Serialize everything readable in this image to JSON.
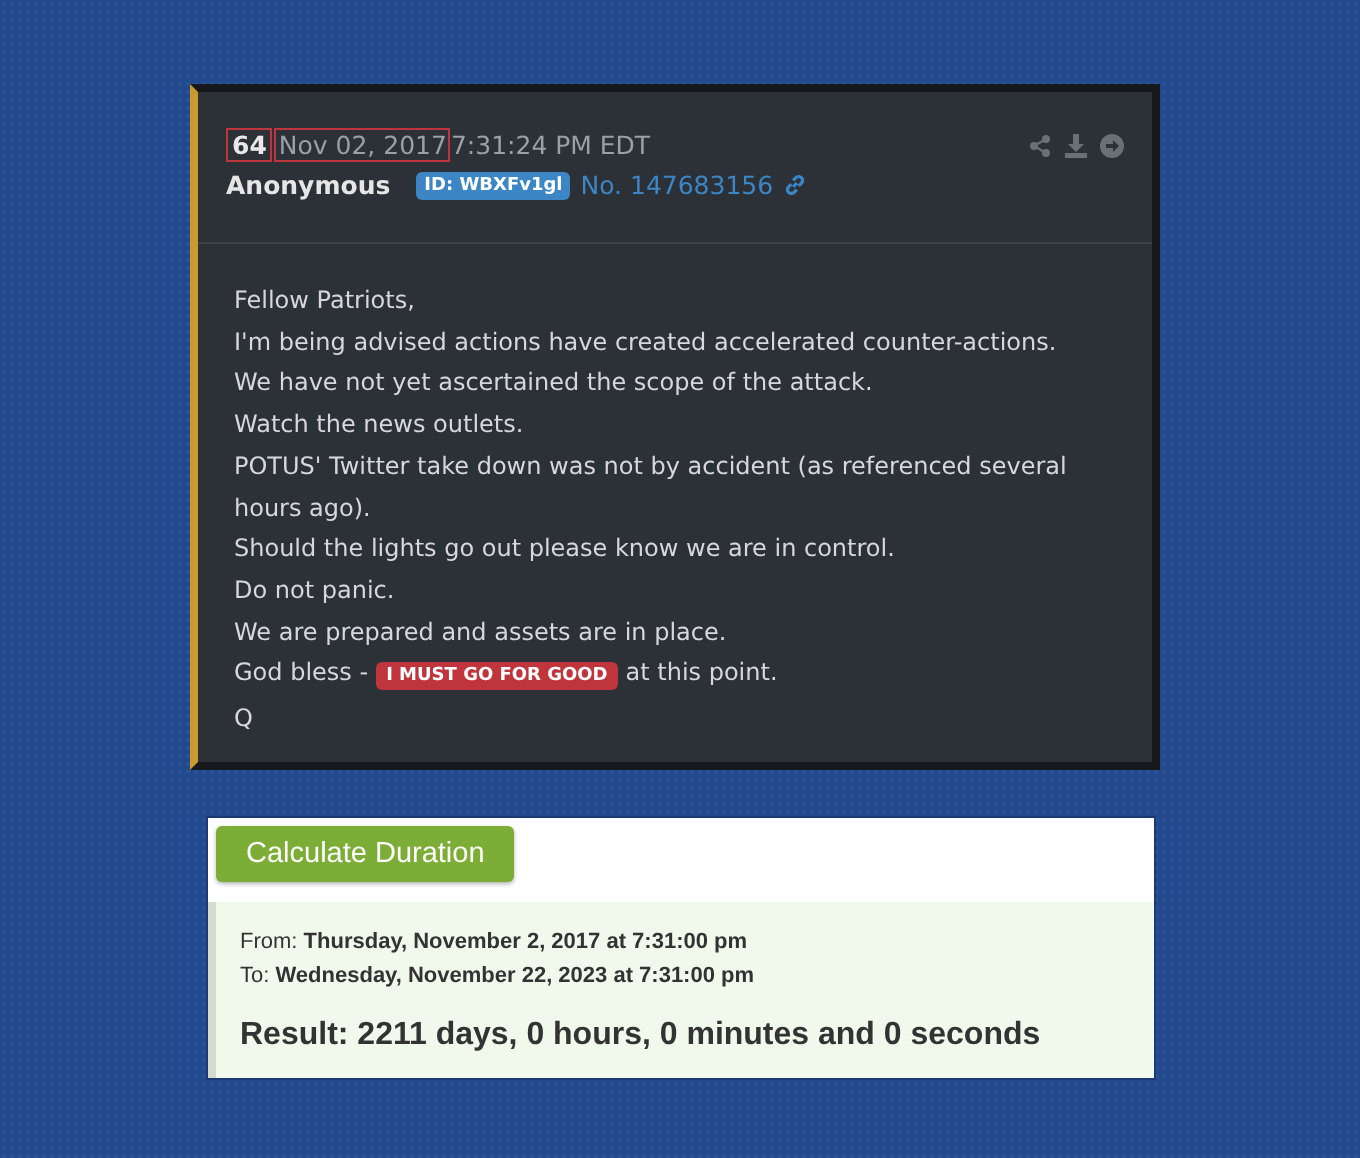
{
  "post": {
    "number": {
      "text": "64",
      "highlighted": true
    },
    "date": {
      "text": "Nov 02, 2017",
      "highlighted": true
    },
    "time": "7:31:24 PM EDT",
    "author": "Anonymous",
    "id_badge": "ID: WBXFv1gl",
    "post_no": "No. 147683156",
    "lines": [
      {
        "kind": "text",
        "text": "Fellow Patriots,"
      },
      {
        "kind": "text",
        "text": "I'm being advised actions have created accelerated counter-actions."
      },
      {
        "kind": "text",
        "text": "We have not yet ascertained the scope of the attack."
      },
      {
        "kind": "text",
        "text": "Watch the news outlets."
      },
      {
        "kind": "text",
        "text": "POTUS' Twitter take down was not by accident (as referenced several hours ago)."
      },
      {
        "kind": "text",
        "text": "Should the lights go out please know we are in control."
      },
      {
        "kind": "text",
        "text": "Do not panic."
      },
      {
        "kind": "text",
        "text": "We are prepared and assets are in place."
      },
      {
        "kind": "badge",
        "before": "God bless -",
        "badge": "I MUST GO FOR GOOD",
        "after": "at this point."
      },
      {
        "kind": "text",
        "text": "Q"
      }
    ]
  },
  "calculator": {
    "button": "Calculate Duration",
    "from": {
      "label": "From:",
      "value": "Thursday, November 2, 2017 at 7:31:00 pm"
    },
    "to": {
      "label": "To:",
      "value": "Wednesday, November 22, 2023 at 7:31:00 pm"
    },
    "result": "Result: 2211 days, 0 hours, 0 minutes and 0 seconds"
  }
}
